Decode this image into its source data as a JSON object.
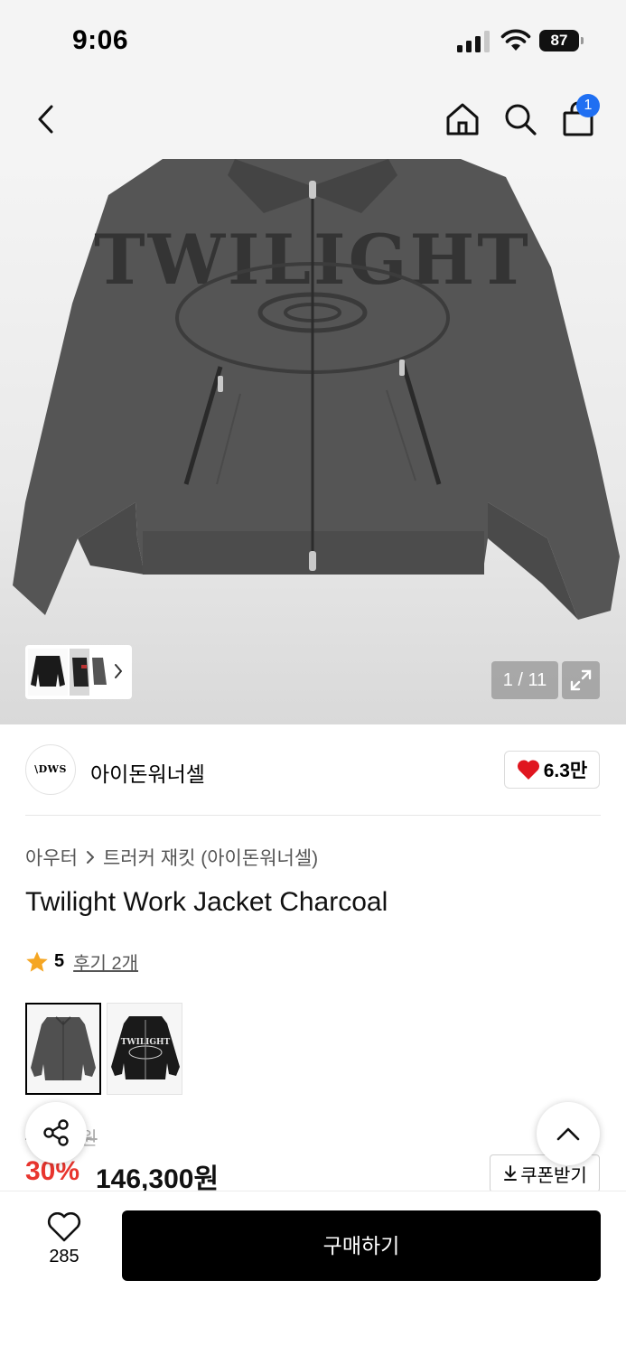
{
  "status_bar": {
    "time": "9:06",
    "battery": "87"
  },
  "nav": {
    "cart_count": "1"
  },
  "gallery": {
    "counter": "1 / 11"
  },
  "brand": {
    "logo_text": "\\DWS",
    "name": "아이돈워너셀",
    "likes": "6.3만"
  },
  "breadcrumb": {
    "category": "아우터",
    "subcategory": "트러커 재킷 (아이돈워너셀)"
  },
  "product": {
    "title": "Twilight Work Jacket Charcoal",
    "rating": "5",
    "reviews": "후기 2개",
    "original_price": "0원",
    "discount": "30%",
    "price": "146,300원",
    "jacket_print": "TWILIGHT"
  },
  "coupon": {
    "label": "쿠폰받기"
  },
  "bottom_bar": {
    "wish_count": "285",
    "buy_label": "구매하기"
  },
  "colors": {
    "accent_red": "#e8352e",
    "badge_blue": "#1f6ff2",
    "heart_red": "#e0161f",
    "star": "#f5a623",
    "jacket_charcoal": "#505050",
    "jacket_black": "#1a1a1a"
  }
}
